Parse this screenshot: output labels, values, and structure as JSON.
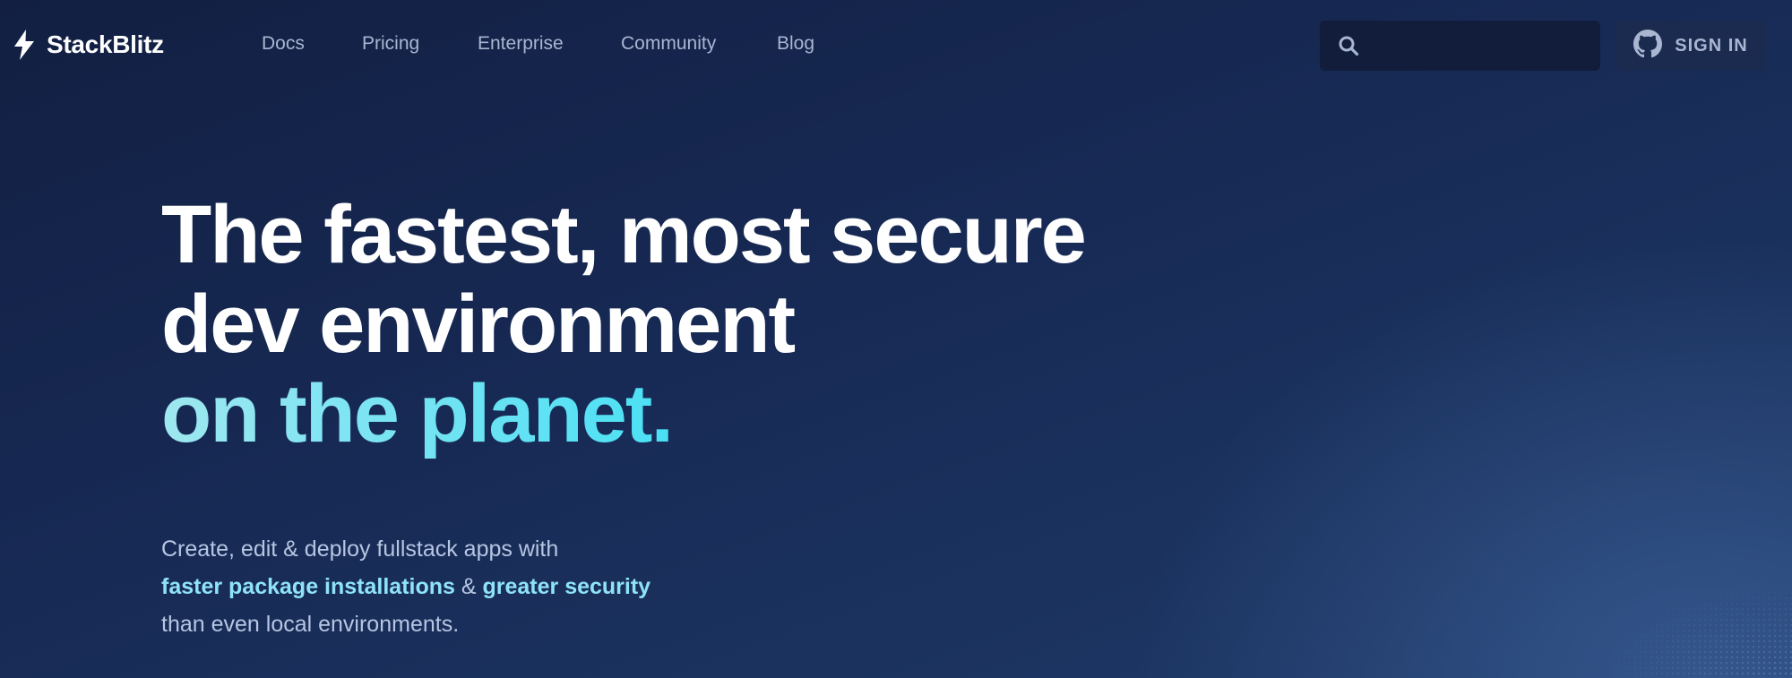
{
  "header": {
    "logo_text": "StackBlitz",
    "logo_icon": "lightning-bolt-icon",
    "nav": [
      {
        "label": "Docs"
      },
      {
        "label": "Pricing"
      },
      {
        "label": "Enterprise"
      },
      {
        "label": "Community"
      },
      {
        "label": "Blog"
      }
    ],
    "search": {
      "placeholder": "",
      "value": "",
      "icon": "search-icon"
    },
    "sign_in": {
      "label": "SIGN IN",
      "icon": "github-icon"
    }
  },
  "hero": {
    "line1": "The fastest, most secure",
    "line2": "dev environment",
    "line3": "on the planet."
  },
  "subtext": {
    "line1": "Create, edit & deploy fullstack apps with",
    "bold1": "faster package installations",
    "amp": " & ",
    "bold2": "greater security",
    "line3": "than even local environments."
  },
  "colors": {
    "background_top": "#121f42",
    "background_bottom": "#1f3a68",
    "accent_cyan": "#22dcf7",
    "nav_text": "#a9b6d2",
    "subtext_bold": "#8fe3f8"
  }
}
